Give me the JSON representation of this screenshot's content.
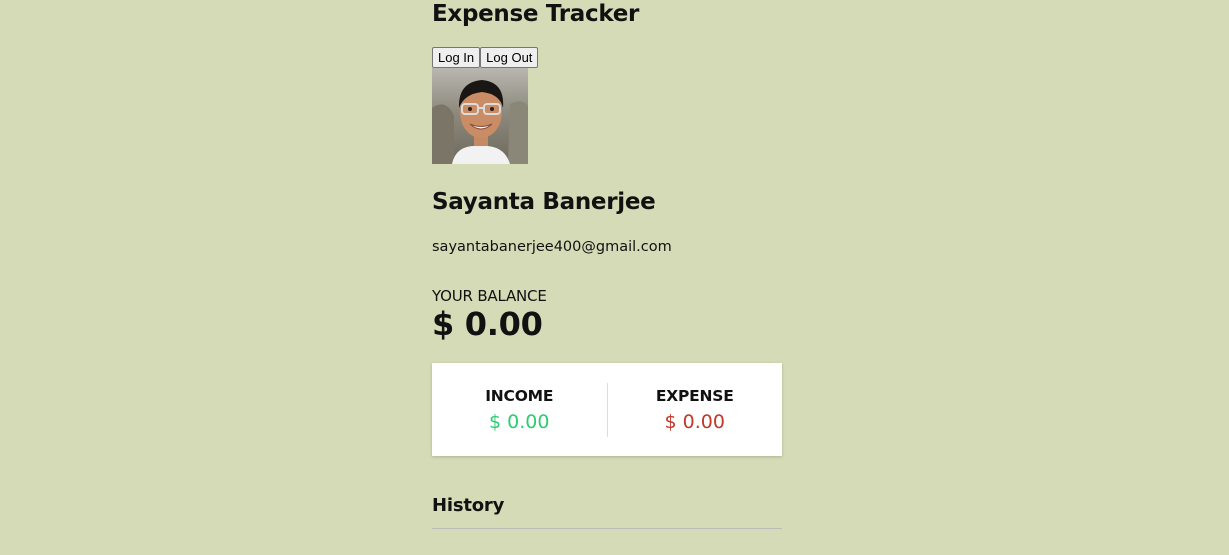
{
  "app": {
    "title": "Expense Tracker"
  },
  "auth": {
    "login_label": "Log In",
    "logout_label": "Log Out"
  },
  "user": {
    "name": "Sayanta Banerjee",
    "email": "sayantabanerjee400@gmail.com",
    "avatar_alt": "Sayanta Banerjee"
  },
  "balance": {
    "label": "YOUR BALANCE",
    "value": "$ 0.00"
  },
  "income": {
    "label": "Income",
    "value": "$ 0.00"
  },
  "expense": {
    "label": "Expense",
    "value": "$ 0.00"
  },
  "history": {
    "title": "History"
  },
  "colors": {
    "page_background": "#d5dbb6",
    "card_background": "#ffffff",
    "income_value": "#2ecc71",
    "expense_value": "#c0392b"
  }
}
